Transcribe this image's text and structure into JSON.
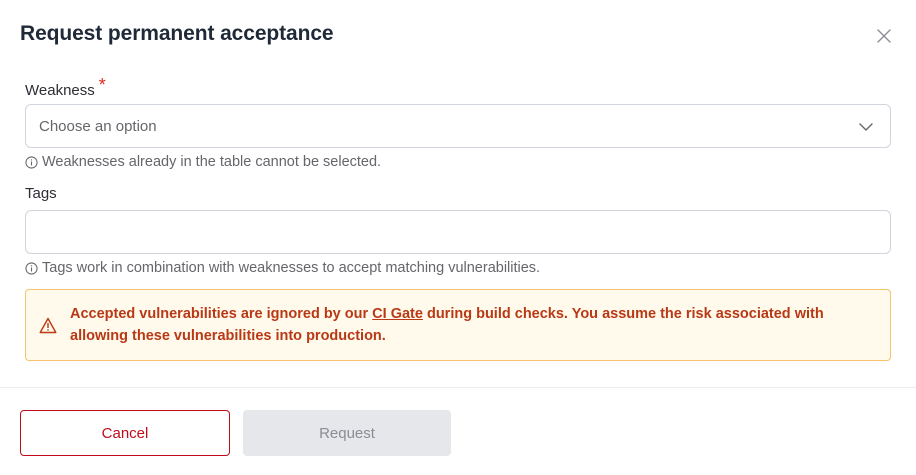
{
  "dialog": {
    "title": "Request permanent acceptance"
  },
  "weakness": {
    "label": "Weakness",
    "required_mark": "*",
    "placeholder": "Choose an option",
    "hint": "Weaknesses already in the table cannot be selected."
  },
  "tags": {
    "label": "Tags",
    "value": "",
    "hint": "Tags work in combination with weaknesses to accept matching vulnerabilities."
  },
  "alert": {
    "text_before": "Accepted vulnerabilities are ignored by our ",
    "link_text": "CI Gate",
    "text_after": " during build checks. You assume the risk associated with allowing these vulnerabilities into production.",
    "color": "#b93815"
  },
  "actions": {
    "cancel_label": "Cancel",
    "request_label": "Request"
  },
  "icons": {
    "close": "close-icon",
    "chevron": "chevron-down-icon",
    "info": "info-icon",
    "warning": "warning-icon"
  },
  "colors": {
    "accent": "#bf0b1a",
    "required": "#d92d20",
    "alert_bg": "#fffaeb",
    "alert_border": "#f4c36b",
    "disabled_bg": "#e6e7ea"
  }
}
